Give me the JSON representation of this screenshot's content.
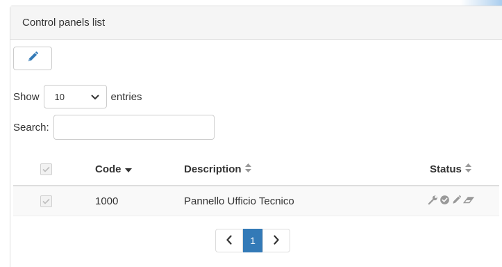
{
  "panel": {
    "title": "Control panels list"
  },
  "toolbar": {
    "edit_icon": "pencil-icon"
  },
  "length": {
    "show_label": "Show",
    "selected": "10",
    "entries_label": "entries"
  },
  "search": {
    "label": "Search:",
    "value": "",
    "placeholder": ""
  },
  "table": {
    "columns": {
      "code": "Code",
      "description": "Description",
      "status": "Status"
    },
    "rows": [
      {
        "code": "1000",
        "description": "Pannello Ufficio Tecnico",
        "status_icons": [
          "wrench-icon",
          "check-circle-icon",
          "pencil-icon",
          "eraser-icon"
        ]
      }
    ]
  },
  "pagination": {
    "current_page": "1"
  },
  "colors": {
    "primary": "#337ab7",
    "header_bg": "#f5f5f5",
    "row_stripe": "#f9f9f9",
    "border": "#dddddd",
    "icon_muted": "#999999"
  }
}
